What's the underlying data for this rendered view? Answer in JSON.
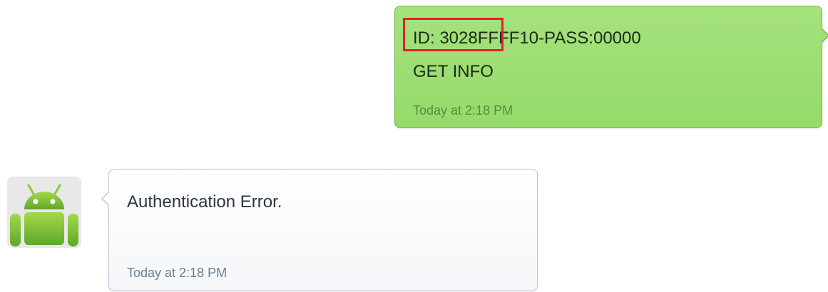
{
  "conversation": {
    "outgoing": {
      "line1": "ID: 3028FFFF10-PASS:00000",
      "line2": "GET INFO",
      "timestamp": "Today at 2:18 PM",
      "bubble_color": "#9edf75",
      "highlight_color": "#e32027"
    },
    "incoming": {
      "avatar_icon": "android-icon",
      "text": "Authentication Error.",
      "timestamp": "Today at 2:18 PM",
      "bubble_color": "#ffffff"
    }
  }
}
